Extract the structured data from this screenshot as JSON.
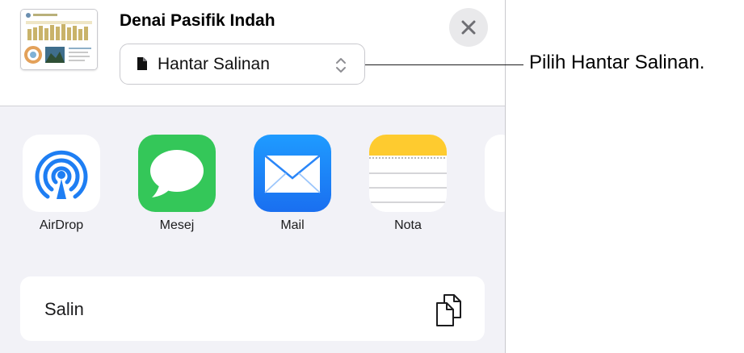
{
  "share_sheet": {
    "document_title": "Denai Pasifik Indah",
    "format_selector": {
      "selected": "Hantar Salinan"
    },
    "apps": [
      {
        "label": "AirDrop",
        "icon": "airdrop-icon"
      },
      {
        "label": "Mesej",
        "icon": "messages-icon"
      },
      {
        "label": "Mail",
        "icon": "mail-icon"
      },
      {
        "label": "Nota",
        "icon": "notes-icon"
      }
    ],
    "actions": [
      {
        "label": "Salin",
        "icon": "copy-icon"
      }
    ]
  },
  "callout": {
    "text": "Pilih Hantar Salinan."
  },
  "colors": {
    "sheet_background": "#f2f2f7",
    "messages_green": "#34c759",
    "mail_blue": "#1a82fb",
    "airdrop_blue": "#1e7ef3",
    "notes_yellow": "#fecb2f"
  }
}
